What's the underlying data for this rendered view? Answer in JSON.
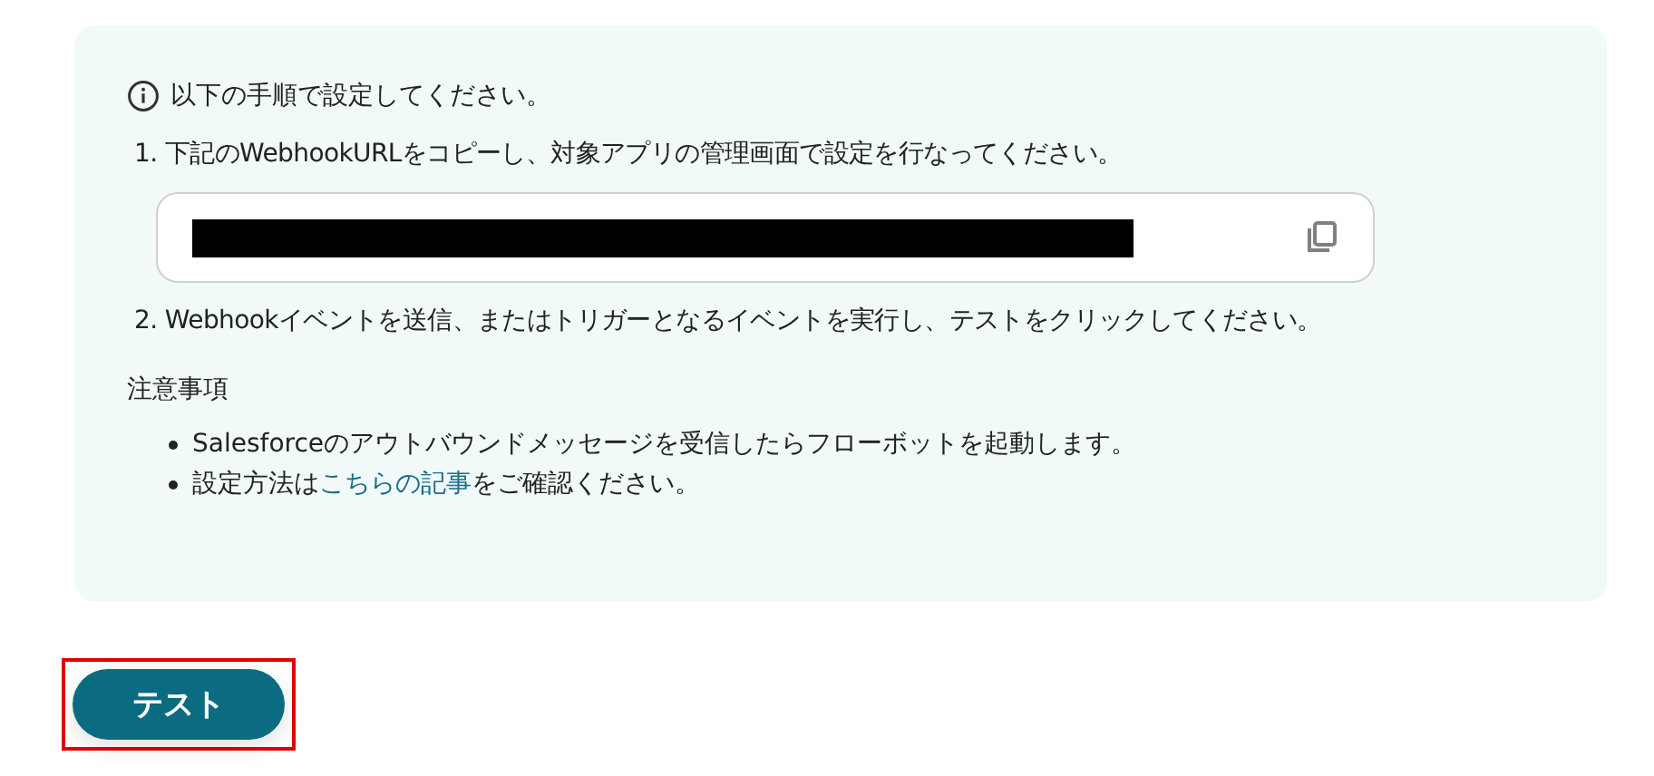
{
  "instructions": {
    "heading": "以下の手順で設定してください。",
    "steps": [
      {
        "text": "1. 下記のWebhookURLをコピーし、対象アプリの管理画面で設定を行なってください。"
      },
      {
        "text": "2. Webhookイベントを送信、またはトリガーとなるイベントを実行し、テストをクリックしてください。"
      }
    ],
    "url_field": {
      "redacted": true
    },
    "notes_title": "注意事項",
    "notes": [
      {
        "text": "Salesforceのアウトバウンドメッセージを受信したらフローボットを起動します。"
      },
      {
        "text": "設定方法は",
        "link": "こちらの記事",
        "after": "をご確認ください。"
      }
    ]
  },
  "test_button": {
    "label": "テスト",
    "highlighted": true
  }
}
